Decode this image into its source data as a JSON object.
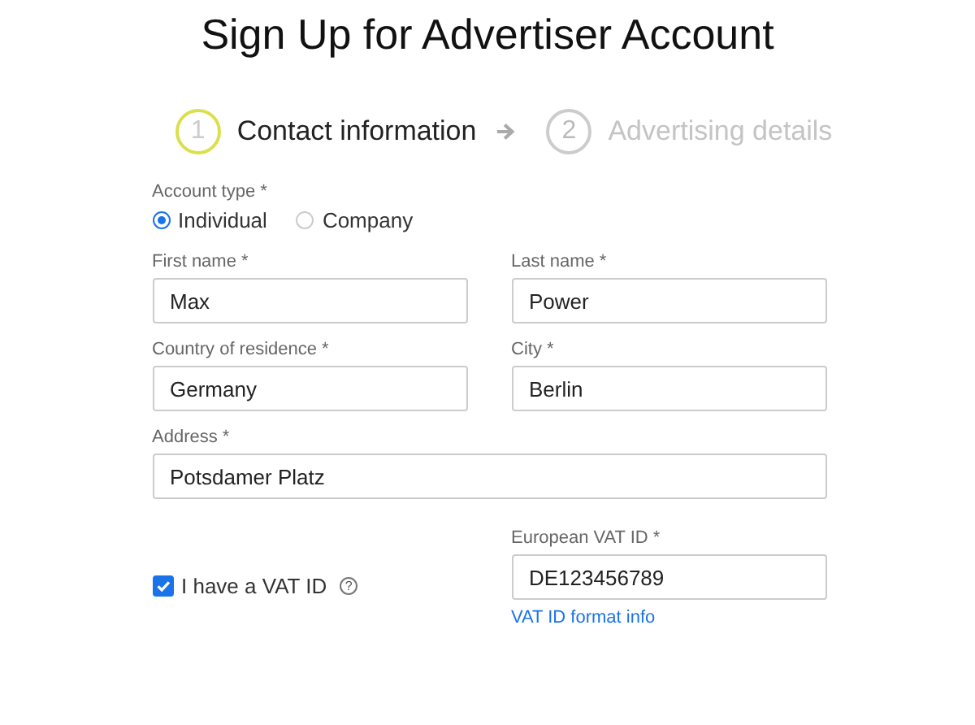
{
  "title": "Sign Up for Advertiser Account",
  "steps": [
    {
      "number": "1",
      "label": "Contact information",
      "selected": true
    },
    {
      "number": "2",
      "label": "Advertising details",
      "selected": false
    }
  ],
  "account_type": {
    "label": "Account type *",
    "options": [
      {
        "label": "Individual",
        "selected": true
      },
      {
        "label": "Company",
        "selected": false
      }
    ]
  },
  "rows": [
    [
      {
        "label": "First name  *",
        "value": "Max"
      },
      {
        "label": "Last name  *",
        "value": "Power"
      }
    ],
    [
      {
        "label": "Country of residence  *",
        "value": "Germany"
      },
      {
        "label": "City  *",
        "value": "Berlin"
      }
    ],
    [
      {
        "label": "Address  *",
        "value": "Potsdamer Platz"
      }
    ]
  ],
  "vat": {
    "checkbox_label": "I have a VAT ID",
    "checked": true,
    "help_icon": "?",
    "field_label": "European VAT ID  *",
    "value": "DE123456789",
    "link": "VAT ID format info"
  }
}
